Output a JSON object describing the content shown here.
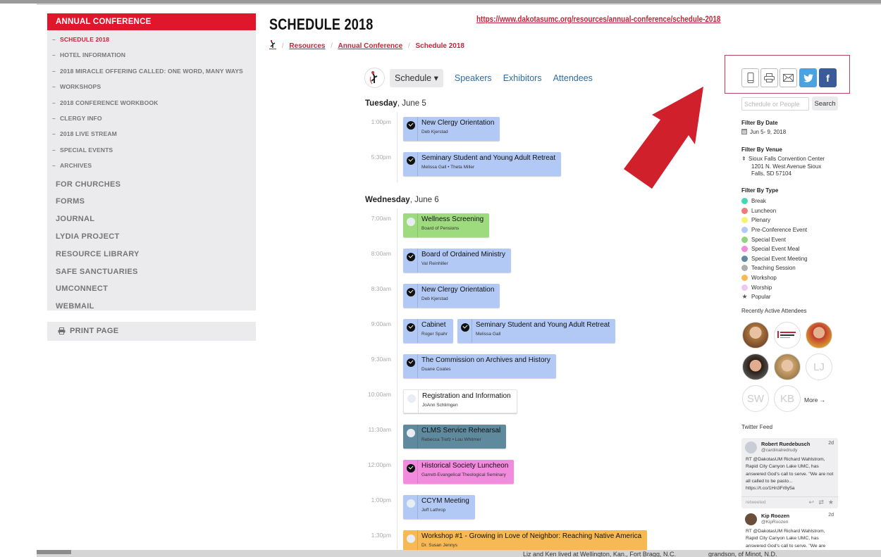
{
  "sidebar": {
    "header": "ANNUAL CONFERENCE",
    "sub_items": [
      {
        "label": "SCHEDULE 2018",
        "active": true
      },
      {
        "label": "HOTEL INFORMATION"
      },
      {
        "label": "2018 MIRACLE OFFERING CALLED: ONE WORD, MANY WAYS"
      },
      {
        "label": "WORKSHOPS"
      },
      {
        "label": "2018 CONFERENCE WORKBOOK"
      },
      {
        "label": "CLERGY INFO"
      },
      {
        "label": "2018 LIVE STREAM"
      },
      {
        "label": "SPECIAL EVENTS"
      },
      {
        "label": "ARCHIVES"
      }
    ],
    "main_items": [
      "FOR CHURCHES",
      "FORMS",
      "JOURNAL",
      "LYDIA PROJECT",
      "RESOURCE LIBRARY",
      "SAFE SANCTUARIES",
      "UMCONNECT",
      "WEBMAIL"
    ],
    "print_label": "PRINT PAGE",
    "dash": "–"
  },
  "header": {
    "title": "SCHEDULE 2018",
    "url": "https://www.dakotasumc.org/resources/annual-conference/schedule-2018",
    "breadcrumb": [
      "Resources",
      "Annual Conference",
      "Schedule 2018"
    ],
    "sep": "/"
  },
  "schedule_nav": {
    "schedule": "Schedule ▾",
    "speakers": "Speakers",
    "exhibitors": "Exhibitors",
    "attendees": "Attendees"
  },
  "days": [
    {
      "weekday": "Tuesday",
      "date": ", June 5",
      "slots": [
        {
          "time": "1:00pm",
          "events": [
            {
              "title": "New Clergy Orientation",
              "sub": "Deb Kjerstad",
              "checked": true,
              "color": "blue"
            }
          ]
        },
        {
          "time": "5:30pm",
          "events": [
            {
              "title": "Seminary Student and Young Adult Retreat",
              "sub": "Melissa Gall • Theta Miller",
              "checked": true,
              "color": "blue"
            }
          ]
        }
      ]
    },
    {
      "weekday": "Wednesday",
      "date": ", June 6",
      "slots": [
        {
          "time": "7:00am",
          "events": [
            {
              "title": "Wellness Screening",
              "sub": "Board of Pensions",
              "checked": false,
              "color": "green"
            }
          ]
        },
        {
          "time": "8:00am",
          "events": [
            {
              "title": "Board of Ordained Ministry",
              "sub": "Val Reinhiller",
              "checked": true,
              "color": "blue"
            }
          ]
        },
        {
          "time": "8:30am",
          "events": [
            {
              "title": "New Clergy Orientation",
              "sub": "Deb Kjerstad",
              "checked": true,
              "color": "blue"
            }
          ]
        },
        {
          "time": "9:00am",
          "events": [
            {
              "title": "Cabinet",
              "sub": "Roger Spahr",
              "checked": true,
              "color": "blue"
            },
            {
              "title": "Seminary Student and Young Adult Retreat",
              "sub": "Melissa Gall",
              "checked": true,
              "color": "blue"
            }
          ]
        },
        {
          "time": "9:30am",
          "events": [
            {
              "title": "The Commission on Archives and History",
              "sub": "Duane Coates",
              "checked": true,
              "color": "blue"
            }
          ]
        },
        {
          "time": "10:00am",
          "events": [
            {
              "title": "Registration and Information",
              "sub": "JoAnn Schlimgen",
              "checked": false,
              "color": "white"
            }
          ]
        },
        {
          "time": "11:30am",
          "events": [
            {
              "title": "CLMS Service Rehearsal",
              "sub": "Rebecca Trefz • Lou Whitmer",
              "checked": false,
              "color": "teal"
            }
          ]
        },
        {
          "time": "12:00pm",
          "events": [
            {
              "title": "Historical Society Luncheon",
              "sub": "Garrett-Evangelical Theological Seminary",
              "checked": true,
              "color": "pink"
            }
          ]
        },
        {
          "time": "1:00pm",
          "events": [
            {
              "title": "CCYM Meeting",
              "sub": "Jeff Lathrop",
              "checked": false,
              "color": "blue"
            }
          ]
        },
        {
          "time": "1:30pm",
          "events": [
            {
              "title": "Workshop #1 - Growing in Love of Neighbor: Reaching Native America",
              "sub": "Dr. Susan Jennys",
              "checked": false,
              "color": "orange"
            }
          ]
        }
      ]
    }
  ],
  "right": {
    "share": [
      "mobile",
      "print",
      "email",
      "twitter",
      "facebook"
    ],
    "search_placeholder": "Schedule or People",
    "search_button": "Search",
    "filter_date_label": "Filter By Date",
    "filter_date_value": "Jun 5- 9, 2018",
    "filter_venue_label": "Filter By Venue",
    "venue_lines": [
      "Sioux Falls Convention Center",
      "1201 N. West Avenue Sioux",
      "Falls, SD 57104"
    ],
    "filter_type_label": "Filter By Type",
    "types": [
      {
        "label": "Break",
        "color": "#45d6b4"
      },
      {
        "label": "Luncheon",
        "color": "#ee7b7b"
      },
      {
        "label": "Plenary",
        "color": "#f8f070"
      },
      {
        "label": "Pre-Conference Event",
        "color": "#b2c8f5"
      },
      {
        "label": "Special Event",
        "color": "#8fd47a"
      },
      {
        "label": "Special Event Meal",
        "color": "#f28ade"
      },
      {
        "label": "Special Event Meeting",
        "color": "#5f8a9e"
      },
      {
        "label": "Teaching Session",
        "color": "#aeaeae"
      },
      {
        "label": "Workshop",
        "color": "#f7b955"
      },
      {
        "label": "Worship",
        "color": "#ecc8f2"
      }
    ],
    "popular_label": "Popular",
    "attendees_label": "Recently Active Attendees",
    "attendee_initials": [
      "LJ",
      "SW",
      "KB"
    ],
    "more_label": "More →",
    "twitter_label": "Twitter Feed",
    "tweets": [
      {
        "name": "Robert Ruedebusch",
        "handle": "@cardinalredrudy",
        "ago": "2d",
        "text": "RT @DakotasUM Richard Wahlstrom, Rapid City Canyon Lake UMC, has answered God's call to serve. \"We are not all called to be pasto... https://t.co/1Hn3Fr8y5a",
        "footer": "retweeted"
      },
      {
        "name": "Kip Roozen",
        "handle": "@KipRoozen",
        "ago": "2d",
        "text": "RT @DakotasUM Richard Wahlstrom, Rapid City Canyon Lake UMC, has answered God's call to serve. \"We are"
      }
    ]
  },
  "overlay_text": {
    "left": "Liz and Ken lived at Wellington, Kan., Fort Bragg, N.C.",
    "right": "grandson, of Minot, N.D."
  }
}
